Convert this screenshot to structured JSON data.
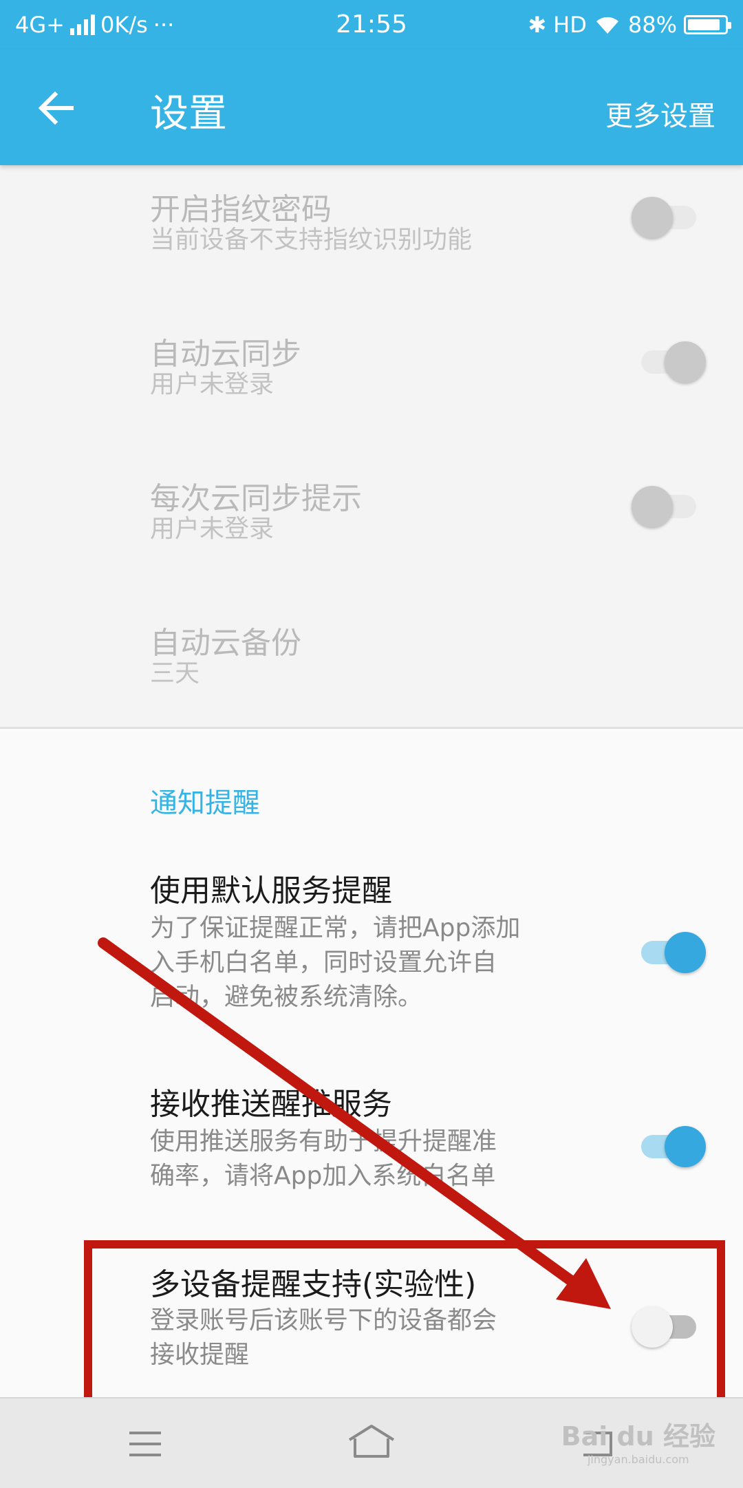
{
  "status_bar": {
    "network": "4G+",
    "speed": "0K/s",
    "dots": "···",
    "time": "21:55",
    "bt": "✱",
    "hd": "HD",
    "battery_pct": "88%",
    "battery_level": 0.88
  },
  "app_bar": {
    "title": "设置",
    "more_label": "更多设置"
  },
  "settings_top": [
    {
      "title": "开启指纹密码",
      "subtitle": "当前设备不支持指纹识别功能",
      "toggle": "off",
      "enabled": false
    },
    {
      "title": "自动云同步",
      "subtitle": "用户未登录",
      "toggle": "on",
      "enabled": false
    },
    {
      "title": "每次云同步提示",
      "subtitle": "用户未登录",
      "toggle": "off",
      "enabled": false
    },
    {
      "title": "自动云备份",
      "subtitle": "三天",
      "enabled": false
    }
  ],
  "notification_section": {
    "header": "通知提醒",
    "items": [
      {
        "title": "使用默认服务提醒",
        "subtitle_lines": [
          "为了保证提醒正常，请把App添加",
          "入手机白名单，同时设置允许自",
          "启动，避免被系统清除。"
        ],
        "toggle": "on"
      },
      {
        "title": "接收推送醒推服务",
        "subtitle_lines": [
          "使用推送服务有助于提升提醒准",
          "确率，请将App加入系统白名单"
        ],
        "toggle": "on"
      },
      {
        "title": "多设备提醒支持(实验性)",
        "subtitle_lines": [
          "登录账号后该账号下的设备都会",
          "接收提醒"
        ],
        "toggle": "off"
      }
    ]
  },
  "annotation": {
    "highlight_color": "#c0170f",
    "arrow_color": "#c0170f"
  },
  "watermark": {
    "line1": "Bai du 经验",
    "line2": "jingyan.baidu.com"
  },
  "colors": {
    "accent": "#35b3e5",
    "switch_on": "#35a8e0"
  }
}
